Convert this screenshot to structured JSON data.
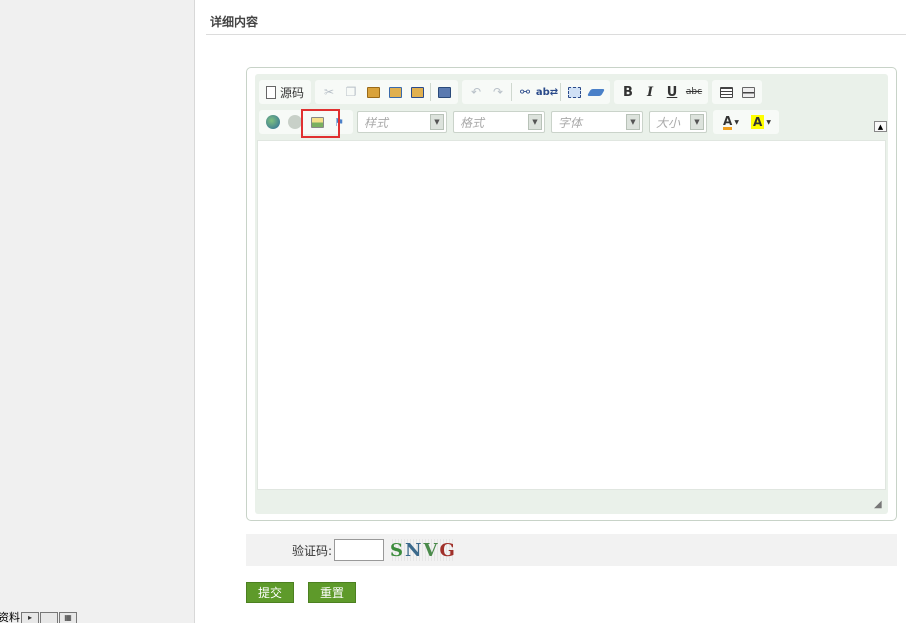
{
  "section": {
    "title": "详细内容"
  },
  "left_panel": {
    "fragment_text": "资料"
  },
  "toolbar": {
    "source_label": "源码",
    "combos": [
      {
        "label": "样式"
      },
      {
        "label": "格式"
      },
      {
        "label": "字体"
      },
      {
        "label": "大小"
      }
    ]
  },
  "captcha": {
    "label": "验证码:",
    "value": "",
    "image_chars": [
      "S",
      "N",
      "V",
      "G"
    ]
  },
  "buttons": {
    "submit": "提交",
    "reset": "重置"
  }
}
